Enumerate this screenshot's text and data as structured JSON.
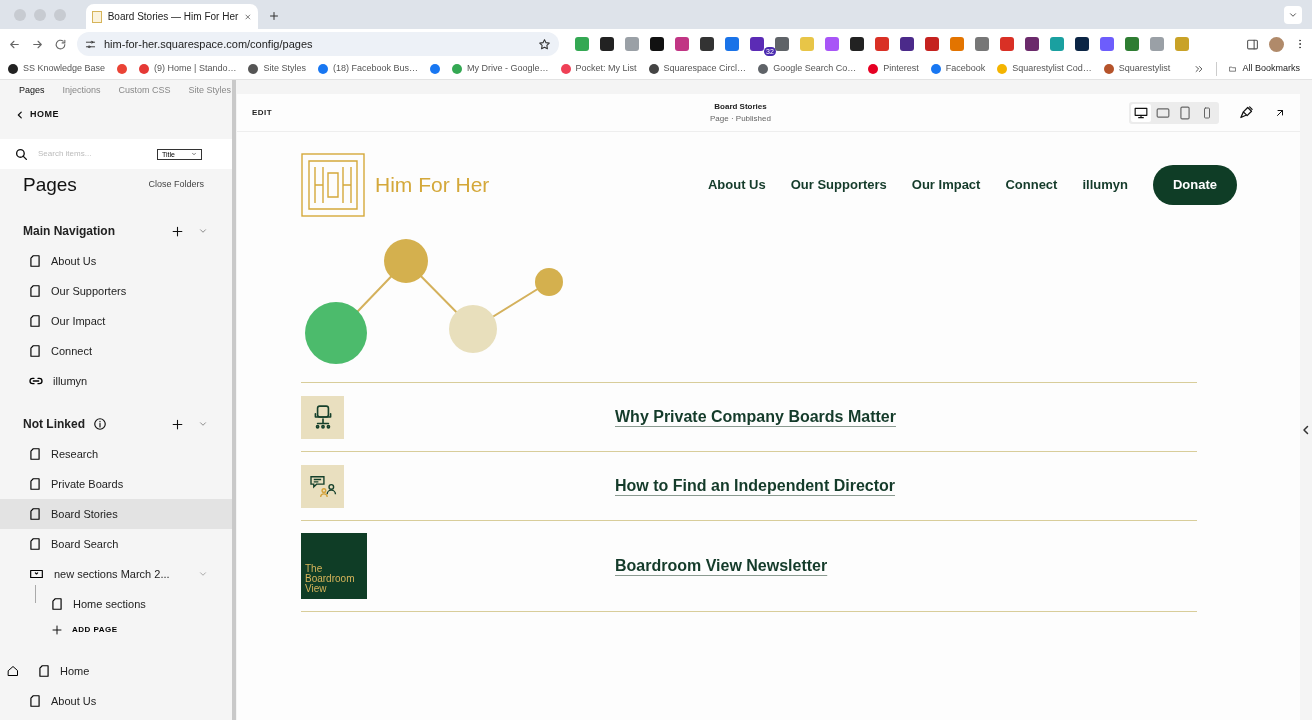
{
  "browser": {
    "tab": {
      "title": "Board Stories — Him For Her"
    },
    "address": "him-for-her.squarespace.com/config/pages",
    "extensions": [
      {
        "color": "#34a853"
      },
      {
        "color": "#222222"
      },
      {
        "color": "#9aa0a6"
      },
      {
        "color": "#111111"
      },
      {
        "color": "#c13584"
      },
      {
        "color": "#333333"
      },
      {
        "color": "#1a73e8"
      },
      {
        "color": "#5b2bb5",
        "badge": "32"
      },
      {
        "color": "#5f6368"
      },
      {
        "color": "#e8c547"
      },
      {
        "color": "#a855f7"
      },
      {
        "color": "#222222"
      },
      {
        "color": "#d93025"
      },
      {
        "color": "#4b2a8a"
      },
      {
        "color": "#c5221f"
      },
      {
        "color": "#e37400"
      },
      {
        "color": "#777777"
      },
      {
        "color": "#d93025"
      },
      {
        "color": "#6b2a6b"
      },
      {
        "color": "#1aa0a0"
      },
      {
        "color": "#0b2545"
      },
      {
        "color": "#6d5dfc"
      },
      {
        "color": "#2e7d32"
      },
      {
        "color": "#9aa0a6"
      },
      {
        "color": "#c9a227"
      }
    ],
    "bookmarks": [
      {
        "label": "SS Knowledge Base",
        "color": "#222222"
      },
      {
        "color": "#ea4335"
      },
      {
        "label": "(9) Home | Stando…",
        "color": "#e53935"
      },
      {
        "label": "Site Styles",
        "color": "#555555"
      },
      {
        "label": "(18) Facebook Bus…",
        "color": "#1877f2"
      },
      {
        "color": "#1877f2"
      },
      {
        "label": "My Drive - Google…",
        "color": "#34a853"
      },
      {
        "label": "Pocket: My List",
        "color": "#ef4056"
      },
      {
        "label": "Squarespace Circl…",
        "color": "#444444"
      },
      {
        "label": "Google Search Co…",
        "color": "#5f6368"
      },
      {
        "label": "Pinterest",
        "color": "#e60023"
      },
      {
        "label": "Facebook",
        "color": "#1877f2"
      },
      {
        "label": "Squarestylist Cod…",
        "color": "#f4b400"
      },
      {
        "label": "Squarestylist",
        "color": "#b5532a"
      }
    ],
    "all_bookmarks": "All Bookmarks"
  },
  "sidebar": {
    "tabs": [
      {
        "label": "Pages",
        "selected": true
      },
      {
        "label": "Injections",
        "selected": false
      },
      {
        "label": "Custom CSS",
        "selected": false
      },
      {
        "label": "Site Styles",
        "selected": false
      }
    ],
    "back": "HOME",
    "search": {
      "placeholder": "Search items...",
      "sort": "Title"
    },
    "heading": "Pages",
    "close_folders": "Close Folders",
    "sections": [
      {
        "title": "Main Navigation",
        "info": false,
        "items": [
          {
            "label": "About Us",
            "kind": "page",
            "selected": false
          },
          {
            "label": "Our Supporters",
            "kind": "page",
            "selected": false
          },
          {
            "label": "Our Impact",
            "kind": "page",
            "selected": false
          },
          {
            "label": "Connect",
            "kind": "page",
            "selected": false
          },
          {
            "label": "illumyn",
            "kind": "link",
            "selected": false
          }
        ]
      },
      {
        "title": "Not Linked",
        "info": true,
        "items": [
          {
            "label": "Research",
            "kind": "page",
            "selected": false
          },
          {
            "label": "Private Boards",
            "kind": "page",
            "selected": false
          },
          {
            "label": "Board Stories",
            "kind": "page",
            "selected": true
          },
          {
            "label": "Board Search",
            "kind": "page",
            "selected": false
          },
          {
            "label": "new sections March 2...",
            "kind": "folder",
            "selected": false,
            "children": [
              {
                "label": "Home sections",
                "kind": "page",
                "selected": false
              }
            ],
            "add": "ADD PAGE"
          }
        ]
      }
    ],
    "other": [
      {
        "label": "Home",
        "kind": "page",
        "home": true,
        "selected": false
      },
      {
        "label": "About Us",
        "kind": "page",
        "home": false,
        "selected": false
      }
    ]
  },
  "editor": {
    "edit": "EDIT",
    "title": "Board Stories",
    "subtitle": "Page · Published",
    "devices": [
      {
        "kind": "desktop",
        "selected": true
      },
      {
        "kind": "tablet-landscape",
        "selected": false
      },
      {
        "kind": "tablet",
        "selected": false
      },
      {
        "kind": "phone",
        "selected": false
      }
    ]
  },
  "site": {
    "brand": "Him For Her",
    "nav": [
      "About Us",
      "Our Supporters",
      "Our Impact",
      "Connect",
      "illumyn"
    ],
    "donate": "Donate",
    "rows": [
      {
        "kind": "chair",
        "title": "Why Private Company Boards Matter"
      },
      {
        "kind": "chat",
        "title": "How to Find an Independent Director"
      },
      {
        "kind": "newsletter",
        "thumb_text": "The Boardroom View",
        "title": "Boardroom View Newsletter"
      }
    ]
  }
}
